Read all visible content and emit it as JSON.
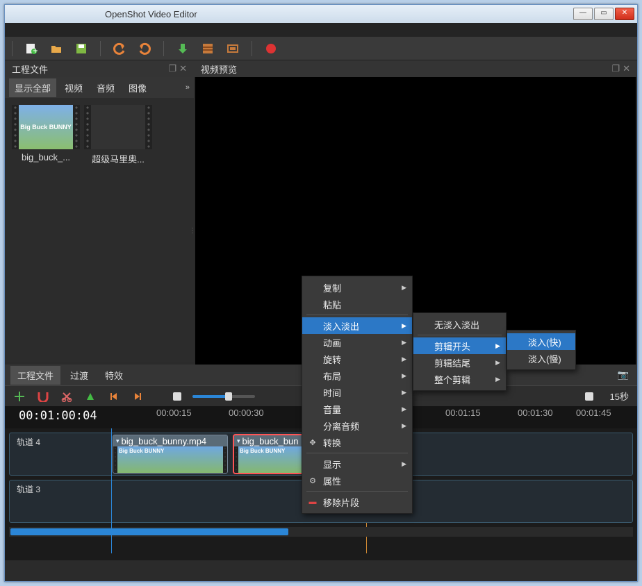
{
  "window": {
    "title": "OpenShot Video Editor"
  },
  "panels": {
    "project_files": "工程文件",
    "video_preview": "视频预览"
  },
  "file_tabs": {
    "show_all": "显示全部",
    "video": "视频",
    "audio": "音频",
    "image": "图像"
  },
  "thumbs": {
    "bbb": "big_buck_...",
    "bbb_inner": "Big Buck\nBUNNY",
    "mario": "超级马里奥..."
  },
  "lower_tabs": {
    "project_files": "工程文件",
    "transitions": "过渡",
    "effects": "特效"
  },
  "timeline": {
    "seconds_label": "15秒",
    "timecode": "00:01:00:04",
    "ticks": [
      "00:00:15",
      "00:00:30",
      "00:01:15",
      "00:01:30",
      "00:01:45"
    ],
    "track4": "轨道 4",
    "track3": "轨道 3",
    "clip1": "big_buck_bunny.mp4",
    "clip2": "big_buck_bun",
    "clip_inner": "Big Buck\nBUNNY"
  },
  "ctx": {
    "copy": "复制",
    "paste": "粘贴",
    "fade": "淡入淡出",
    "animate": "动画",
    "rotate": "旋转",
    "layout": "布局",
    "time": "时间",
    "volume": "音量",
    "separate_audio": "分离音频",
    "transform": "转换",
    "display": "显示",
    "properties": "属性",
    "remove_clip": "移除片段"
  },
  "ctx2": {
    "no_fade": "无淡入淡出",
    "clip_start": "剪辑开头",
    "clip_end": "剪辑结尾",
    "whole_clip": "整个剪辑"
  },
  "ctx3": {
    "fade_fast": "淡入(快)",
    "fade_slow": "淡入(慢)"
  }
}
